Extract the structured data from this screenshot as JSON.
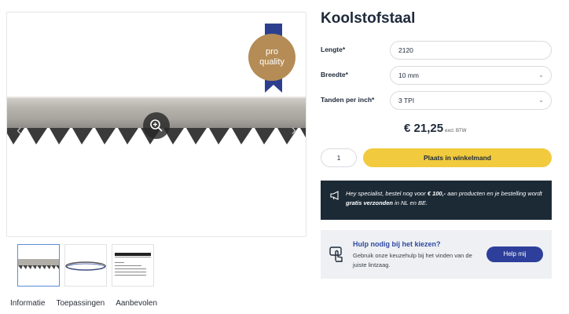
{
  "product": {
    "title": "Koolstofstaal",
    "badge": {
      "line1": "pro",
      "line2": "quality"
    }
  },
  "gallery": {
    "zoom_icon": "zoom-in-icon",
    "prev_icon": "chevron-left-icon",
    "next_icon": "chevron-right-icon",
    "thumbnails": [
      "blade-closeup",
      "blade-loop",
      "spec-sheet"
    ]
  },
  "options": {
    "length": {
      "label": "Lengte*",
      "value": "2120"
    },
    "width": {
      "label": "Breedte*",
      "value": "10 mm"
    },
    "teeth": {
      "label": "Tanden per inch*",
      "value": "3 TPI"
    }
  },
  "price": {
    "amount": "€ 21,25",
    "note": "excl. BTW"
  },
  "cart": {
    "quantity": "1",
    "button_label": "Plaats in winkelmand"
  },
  "promo": {
    "part1": "Hey specialist, bestel nog voor ",
    "amount": "€ 100,-",
    "part2": " aan producten en je bestelling wordt ",
    "highlight": "gratis verzonden",
    "part3": " in NL en BE."
  },
  "help": {
    "title": "Hulp nodig bij het kiezen?",
    "text": "Gebruik onze keuzehulp bij het vinden van de juiste lintzaag.",
    "button_label": "Help mij"
  },
  "tabs": [
    "Informatie",
    "Toepassingen",
    "Aanbevolen"
  ],
  "colors": {
    "accent_yellow": "#f1ca3e",
    "navy": "#1c2a36",
    "button_blue": "#2d3f9a",
    "badge_gold": "#b58c55",
    "ribbon_blue": "#2c3f8f"
  }
}
